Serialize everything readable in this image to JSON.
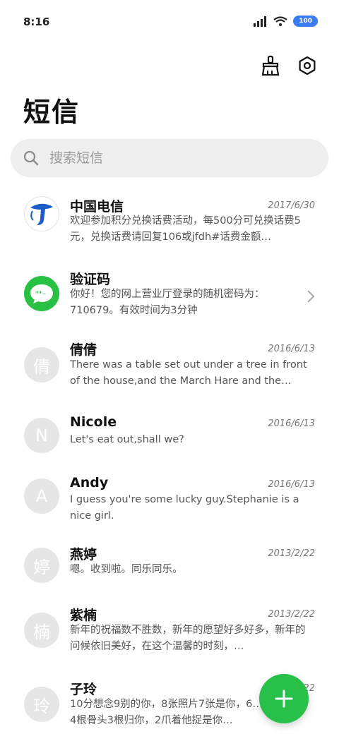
{
  "status": {
    "time": "8:16",
    "battery": "100"
  },
  "header": {
    "title": "短信"
  },
  "search": {
    "placeholder": "搜索短信"
  },
  "messages": [
    {
      "name": "中国电信",
      "date": "2017/6/30",
      "preview": "欢迎参加积分兑换话费活动，每500分可兑换话费5元，兑换话费请回复106或jfdh#话费金额…",
      "avatar": "telecom-logo"
    },
    {
      "name": "验证码",
      "date": "",
      "preview": "你好！您的网上营业厅登录的随机密码为：710679。有效时间为3分钟",
      "avatar": "message-bubble"
    },
    {
      "name": "倩倩",
      "date": "2016/6/13",
      "preview": "There was a table set out under a tree in front of the house,and the March Hare and the Hatte…",
      "avatar_letter": "倩"
    },
    {
      "name": "Nicole",
      "date": "2016/6/13",
      "preview": "Let's eat out,shall we?",
      "avatar_letter": "N"
    },
    {
      "name": "Andy",
      "date": "2016/6/13",
      "preview": "I guess you're some lucky guy.Stephanie is a nice girl.",
      "avatar_letter": "A"
    },
    {
      "name": "燕婷",
      "date": "2013/2/22",
      "preview": "嗯。收到啦。同乐同乐。",
      "avatar_letter": "婷"
    },
    {
      "name": "紫楠",
      "date": "2013/2/22",
      "preview": "新年的祝福数不胜数，新年的愿望好多好多，新年的问候依旧美好，在这个温馨的时刻，…",
      "avatar_letter": "楠"
    },
    {
      "name": "子玲",
      "date": "2013/2/22",
      "preview": "10分想念9别的你，8张照片7张是你，6…5只像你，4根骨头3根归你，2爪着他捉是你…",
      "avatar_letter": "玲"
    }
  ],
  "colors": {
    "accent": "#27c149",
    "battery": "#3b7cf4",
    "telecom": "#1a5cc8"
  }
}
